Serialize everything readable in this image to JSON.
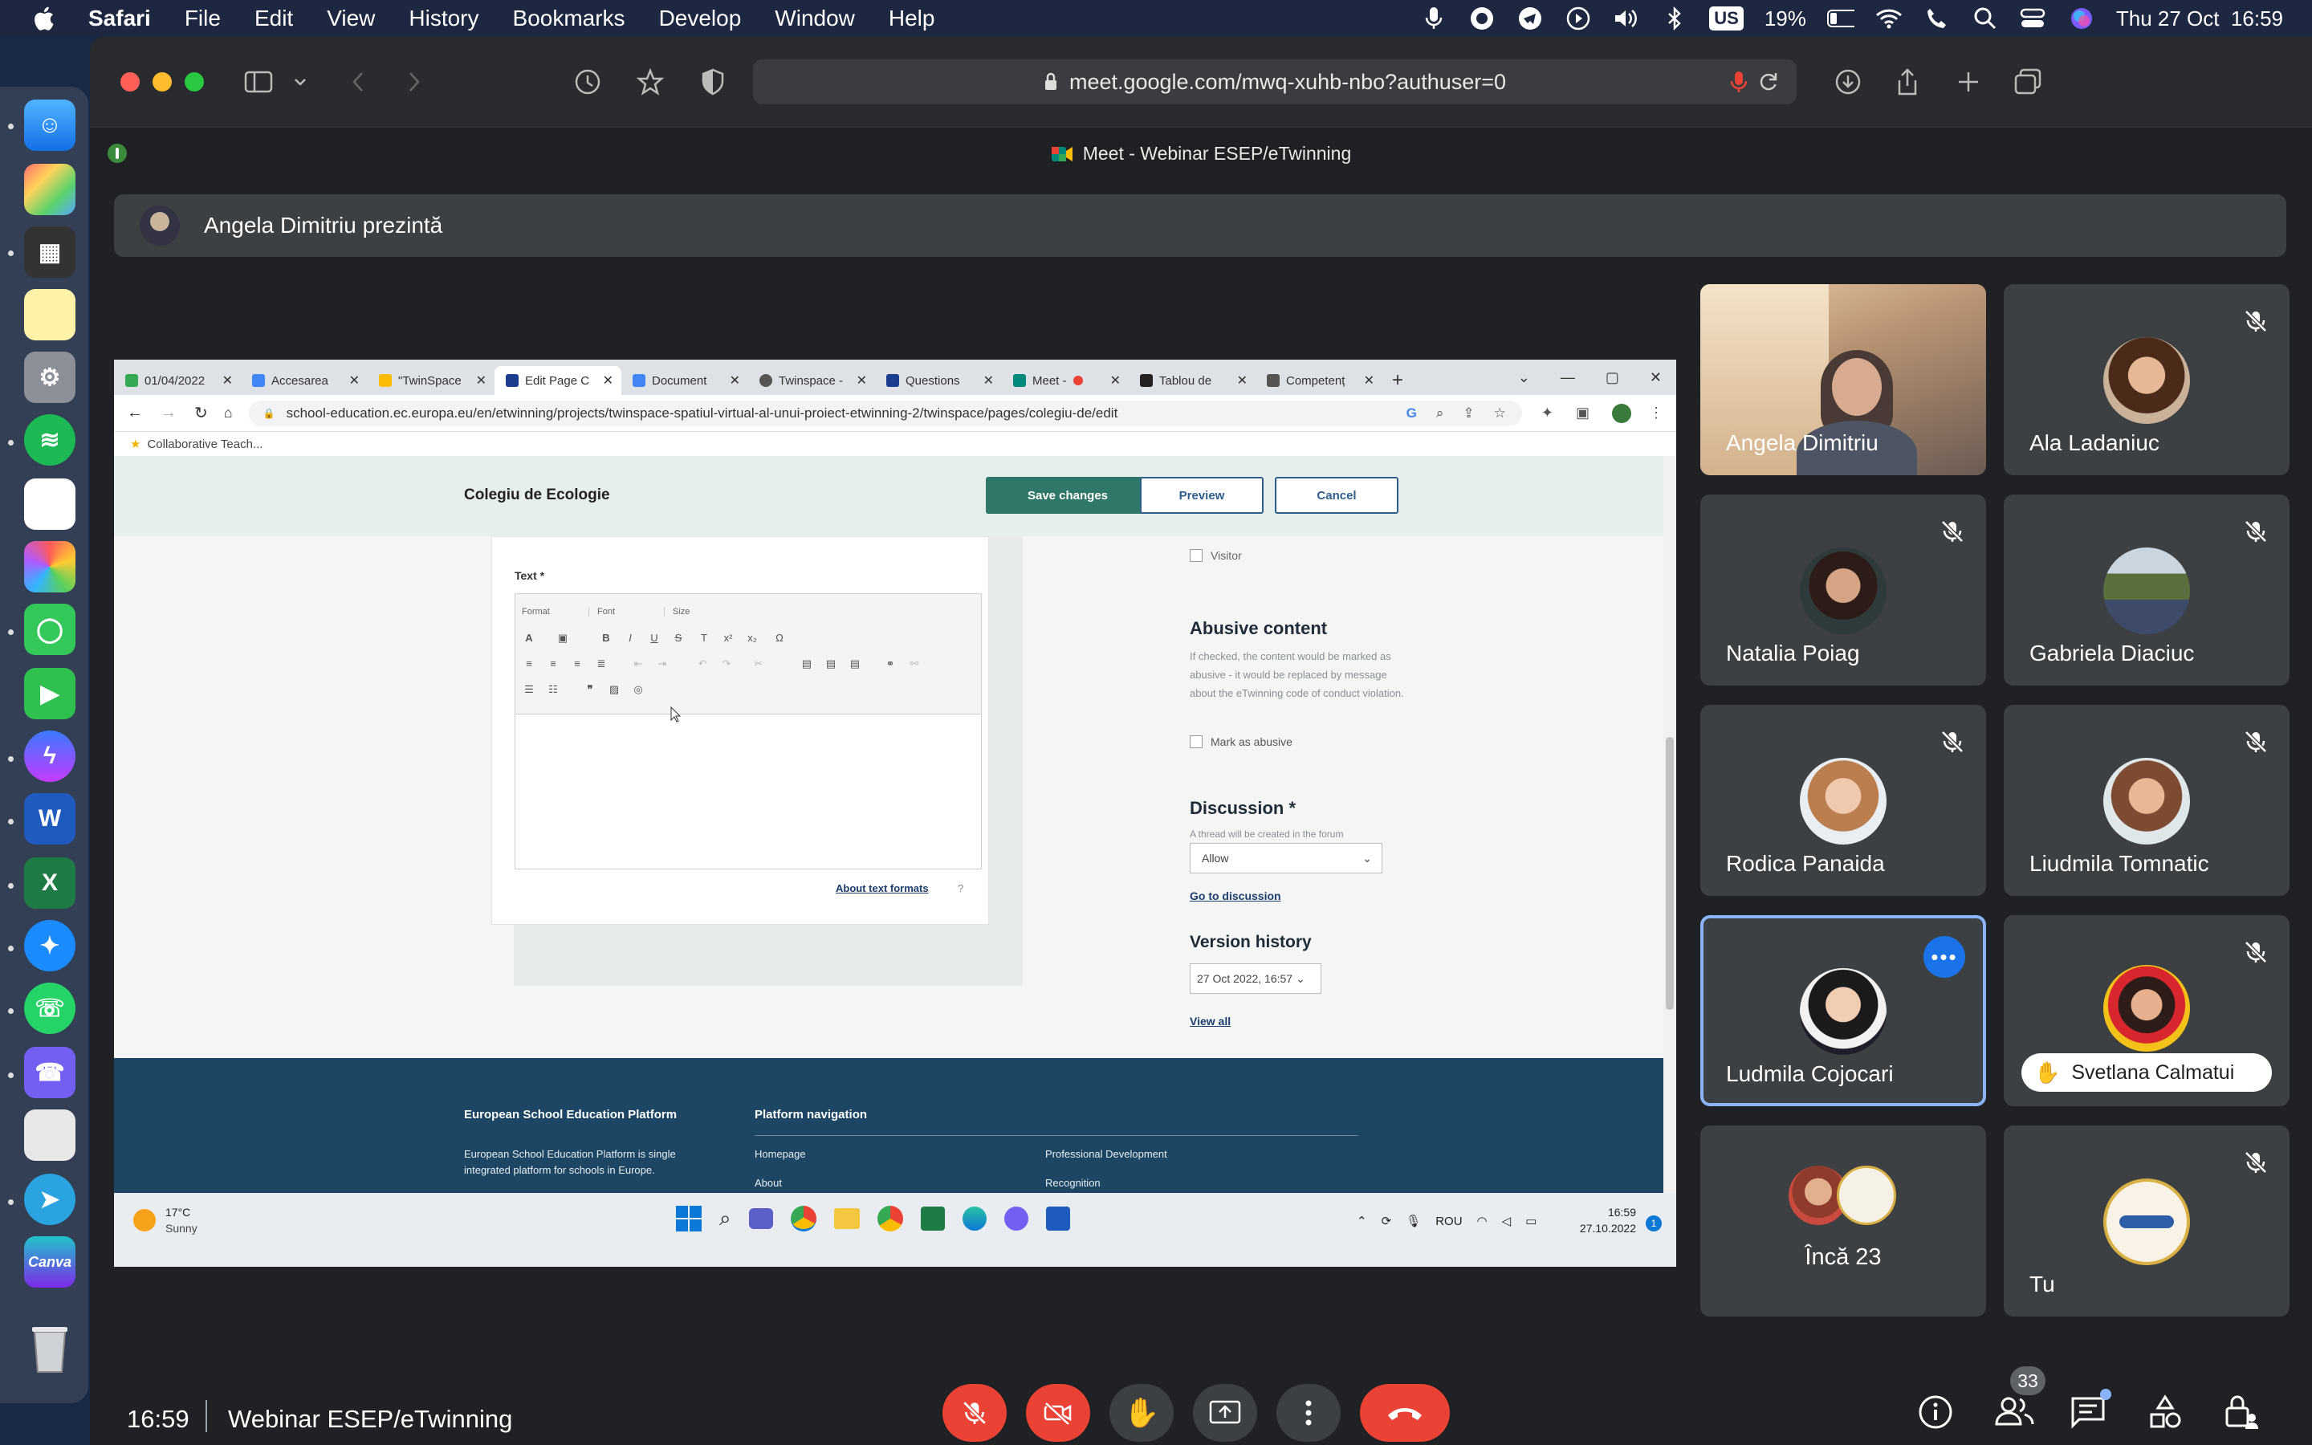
{
  "menubar": {
    "app": "Safari",
    "items": [
      "File",
      "Edit",
      "View",
      "History",
      "Bookmarks",
      "Develop",
      "Window",
      "Help"
    ],
    "keyboard": "US",
    "battery": "19%",
    "datetime": "Thu 27 Oct  16:59"
  },
  "safari": {
    "url": "meet.google.com/mwq-xuhb-nbo?authuser=0",
    "tab_title": "Meet - Webinar ESEP/eTwinning"
  },
  "meet": {
    "presenting": "Angela Dimitriu prezintă",
    "time": "16:59",
    "meeting_name": "Webinar ESEP/eTwinning",
    "people_count": "33",
    "participants": [
      {
        "name": "Angela Dimitriu",
        "muted": false,
        "video": true
      },
      {
        "name": "Ala Ladaniuc",
        "muted": true
      },
      {
        "name": "Natalia Poiag",
        "muted": true
      },
      {
        "name": "Gabriela Diaciuc",
        "muted": true
      },
      {
        "name": "Rodica Panaida",
        "muted": true
      },
      {
        "name": "Liudmila Tomnatic",
        "muted": true
      },
      {
        "name": "Ludmila Cojocari",
        "muted": false,
        "active": true
      },
      {
        "name": "Svetlana Calmatui",
        "muted": true,
        "hand_raised": true
      },
      {
        "name": "Încă 23",
        "muted": false
      },
      {
        "name": "Tu",
        "muted": true
      }
    ],
    "accent_red": "#ea4335",
    "accent_blue": "#8ab4f8"
  },
  "shared": {
    "chrome_tabs": [
      {
        "title": "01/04/2022",
        "color": "#34a853"
      },
      {
        "title": "Accesarea",
        "color": "#4285f4"
      },
      {
        "title": "\"TwinSpace",
        "color": "#fbbc04"
      },
      {
        "title": "Edit Page C",
        "color": "#1a3d8f",
        "active": true
      },
      {
        "title": "Document",
        "color": "#4285f4"
      },
      {
        "title": "Twinspace -",
        "color": "#555555"
      },
      {
        "title": "Questions",
        "color": "#1a3d8f"
      },
      {
        "title": "Meet -",
        "color": "#00897b"
      },
      {
        "title": "Tablou de",
        "color": "#222222"
      },
      {
        "title": "Competenț",
        "color": "#555555"
      }
    ],
    "address": "school-education.ec.europa.eu/en/etwinning/projects/twinspace-spatiul-virtual-al-unui-proiect-etwinning-2/twinspace/pages/colegiu-de/edit",
    "bookmark": "Collaborative Teach...",
    "page_title": "Colegiu de Ecologie",
    "save_btn": "Save changes",
    "preview_btn": "Preview",
    "cancel_btn": "Cancel",
    "text_label": "Text *",
    "format_sel": "Format",
    "font_sel": "Font",
    "size_sel": "Size",
    "about_formats": "About text formats",
    "visitor": "Visitor",
    "abusive_title": "Abusive content",
    "abusive_desc": "If checked, the content would be marked as abusive - it would be replaced by message about the eTwinning code of conduct violation.",
    "mark_abusive": "Mark as abusive",
    "discussion_title": "Discussion *",
    "discussion_desc": "A thread will be created in the forum",
    "discussion_value": "Allow",
    "go_discussion": "Go to discussion",
    "version_title": "Version history",
    "version_value": "27 Oct 2022, 16:57",
    "view_all": "View all",
    "footer_col1_title": "European School Education Platform",
    "footer_col1_text": "European School Education Platform is single integrated platform for schools in Europe.",
    "footer_col2_title": "Platform navigation",
    "footer_links": [
      "Homepage",
      "About",
      "Professional Development",
      "Recognition"
    ],
    "weather_temp": "17°C",
    "weather_desc": "Sunny",
    "lang": "ROU",
    "win_time": "16:59",
    "win_date": "27.10.2022"
  }
}
